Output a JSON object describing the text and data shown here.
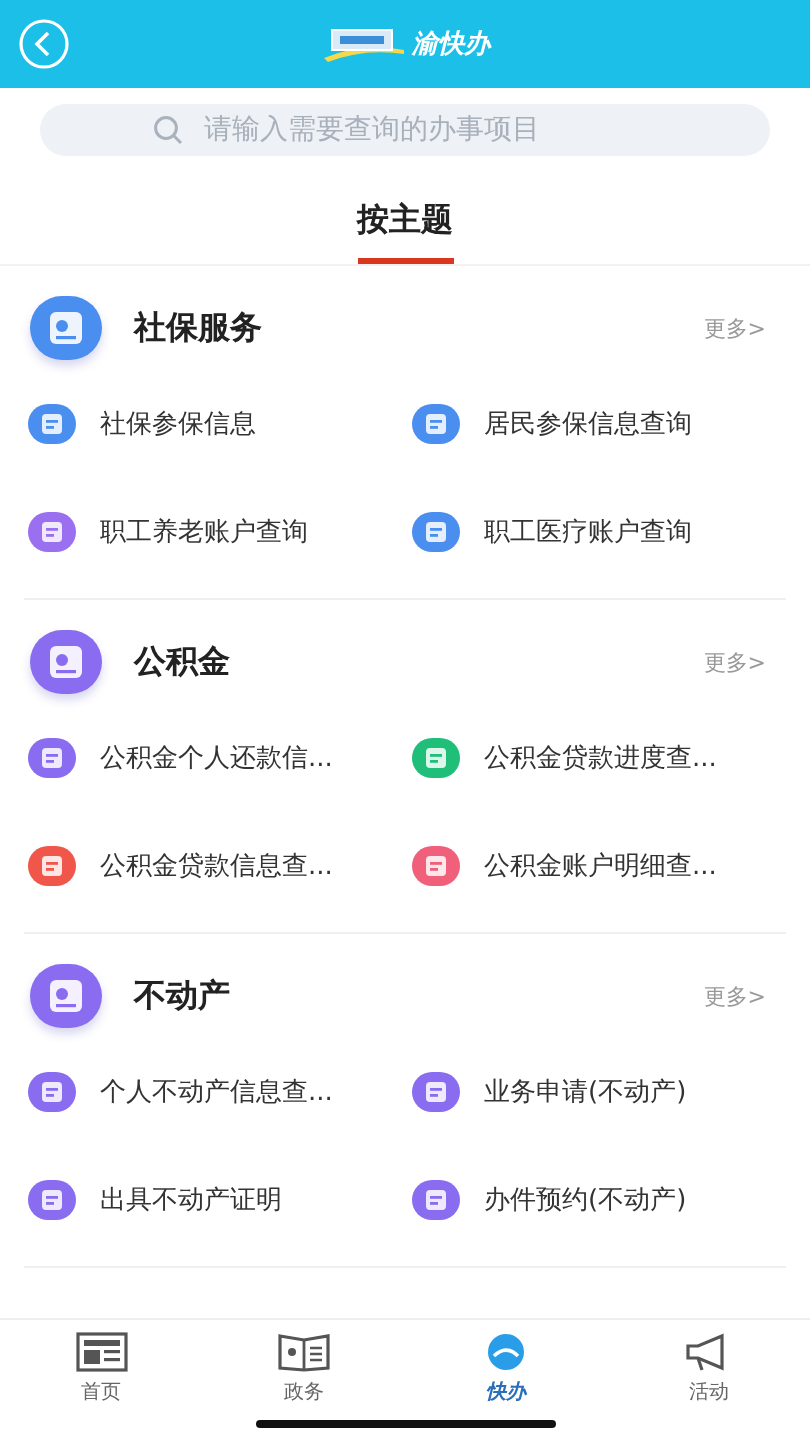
{
  "header": {
    "logo_text": "渝快办"
  },
  "search": {
    "placeholder": "请输入需要查询的办事项目"
  },
  "topic_tab": {
    "label": "按主题",
    "selected": true
  },
  "sections": [
    {
      "title": "社保服务",
      "more": "更多>",
      "color": "#4a8ef0",
      "items": [
        {
          "label": "社保参保信息",
          "color": "#4a8ef0"
        },
        {
          "label": "居民参保信息查询",
          "color": "#4a8ef0"
        },
        {
          "label": "职工养老账户查询",
          "color": "#9a6ff0"
        },
        {
          "label": "职工医疗账户查询",
          "color": "#4a8ef0"
        }
      ]
    },
    {
      "title": "公积金",
      "more": "更多>",
      "color": "#8a6cf0",
      "items": [
        {
          "label": "公积金个人还款信...",
          "color": "#8a6cf0"
        },
        {
          "label": "公积金贷款进度查...",
          "color": "#1fbf7a"
        },
        {
          "label": "公积金贷款信息查...",
          "color": "#f0564a"
        },
        {
          "label": "公积金账户明细查...",
          "color": "#f0607a"
        }
      ]
    },
    {
      "title": "不动产",
      "more": "更多>",
      "color": "#8a6cf0",
      "items": [
        {
          "label": "个人不动产信息查...",
          "color": "#8a6cf0"
        },
        {
          "label": "业务申请(不动产)",
          "color": "#8a6cf0"
        },
        {
          "label": "出具不动产证明",
          "color": "#8a6cf0"
        },
        {
          "label": "办件预约(不动产)",
          "color": "#8a6cf0"
        }
      ]
    }
  ],
  "tab_bar": [
    {
      "label": "首页",
      "kind": "news"
    },
    {
      "label": "政务",
      "kind": "book"
    },
    {
      "label": "快办",
      "kind": "logo"
    },
    {
      "label": "活动",
      "kind": "megaphone"
    }
  ]
}
